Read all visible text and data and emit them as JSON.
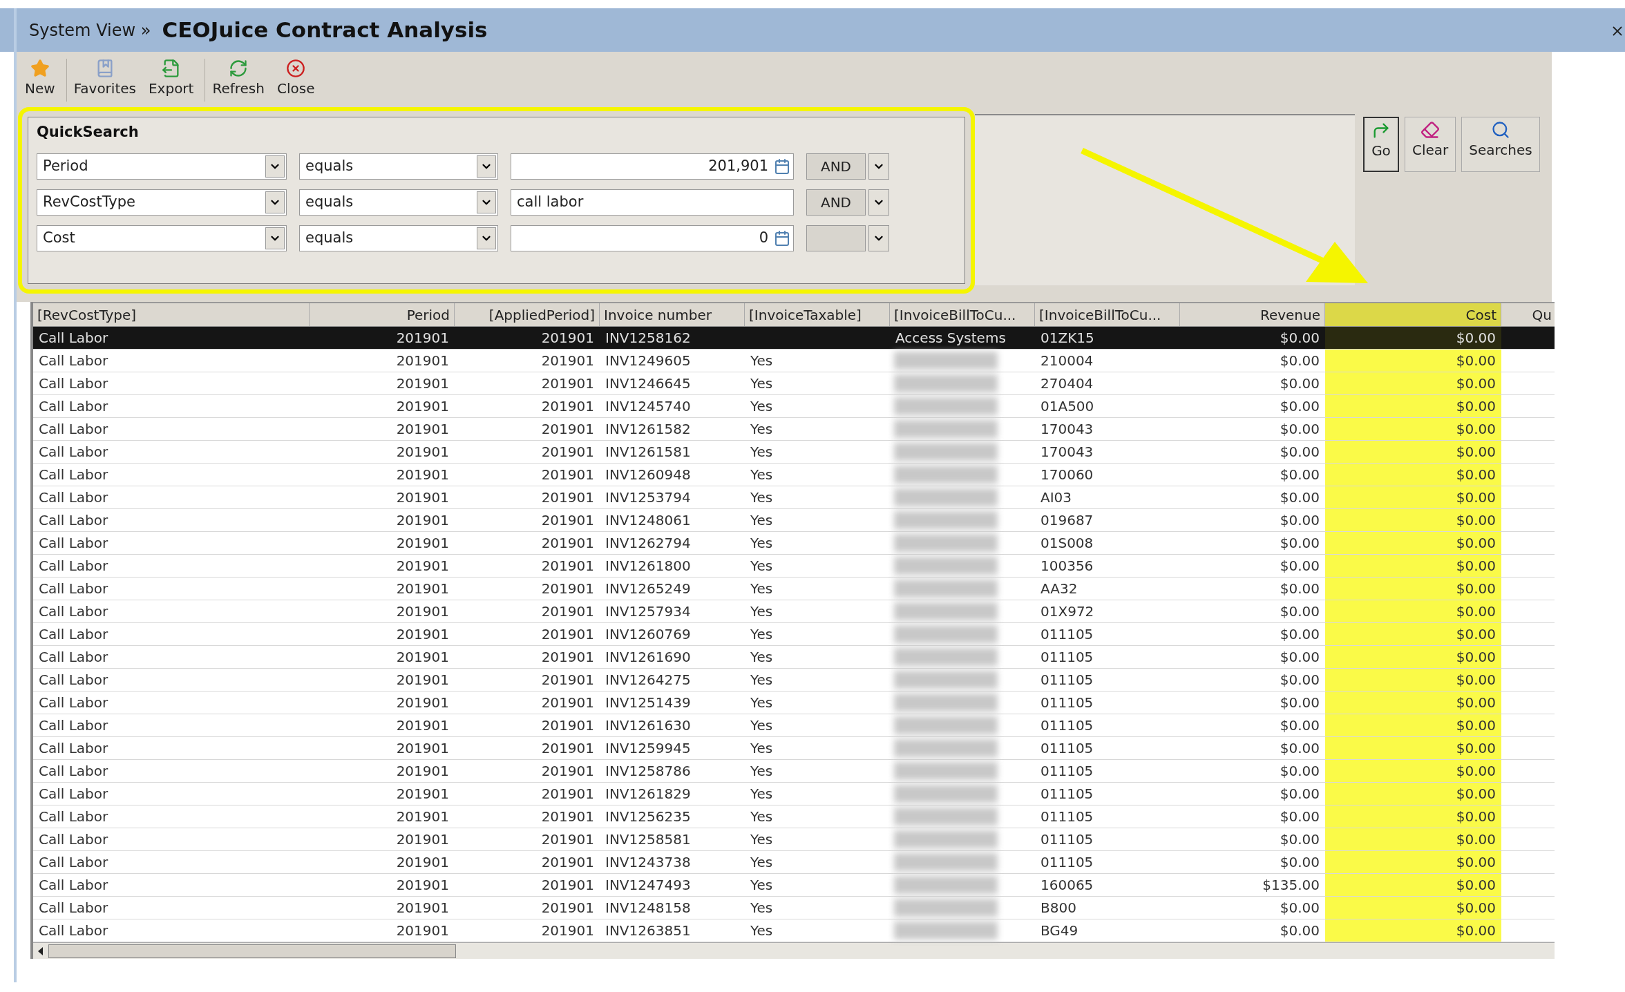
{
  "window": {
    "breadcrumb": "System View »",
    "title": "CEOJuice Contract Analysis"
  },
  "toolbar": [
    {
      "label": "New",
      "kind": "new"
    },
    {
      "label": "Favorites",
      "kind": "favorites"
    },
    {
      "label": "Export",
      "kind": "export"
    },
    {
      "label": "Refresh",
      "kind": "refresh"
    },
    {
      "label": "Close",
      "kind": "close"
    }
  ],
  "quicksearch": {
    "title": "QuickSearch",
    "highlighted": true,
    "rows": [
      {
        "field": "Period",
        "operator": "equals",
        "value": "201,901",
        "kind": "number",
        "join": "AND"
      },
      {
        "field": "RevCostType",
        "operator": "equals",
        "value": "call labor",
        "kind": "text",
        "join": "AND"
      },
      {
        "field": "Cost",
        "operator": "equals",
        "value": "0",
        "kind": "number"
      }
    ]
  },
  "search_buttons": [
    {
      "label": "Go",
      "kind": "go"
    },
    {
      "label": "Clear",
      "kind": "clear"
    },
    {
      "label": "Searches",
      "kind": "searches"
    }
  ],
  "annotation_arrow": true,
  "table": {
    "columns": [
      {
        "label": "[RevCostType]",
        "highlighted": false
      },
      {
        "label": "Period",
        "highlighted": false
      },
      {
        "label": "[AppliedPeriod]",
        "highlighted": false
      },
      {
        "label": "Invoice number",
        "highlighted": false
      },
      {
        "label": "[InvoiceTaxable]",
        "highlighted": false
      },
      {
        "label": "[InvoiceBillToCu...",
        "highlighted": false
      },
      {
        "label": "[InvoiceBillToCu...",
        "highlighted": false
      },
      {
        "label": "Revenue",
        "highlighted": false
      },
      {
        "label": "Cost",
        "highlighted": true
      },
      {
        "label": "Qu",
        "highlighted": false
      }
    ],
    "rows": [
      {
        "cells": [
          "Call Labor",
          "201901",
          "201901",
          "INV1258162",
          "",
          "Access Systems",
          "01ZK15",
          "$0.00",
          "$0.00"
        ],
        "selected": true
      },
      {
        "cells": [
          "Call Labor",
          "201901",
          "201901",
          "INV1249605",
          "Yes",
          "",
          "210004",
          "$0.00",
          "$0.00"
        ],
        "selected": false
      },
      {
        "cells": [
          "Call Labor",
          "201901",
          "201901",
          "INV1246645",
          "Yes",
          "",
          "270404",
          "$0.00",
          "$0.00"
        ],
        "selected": false
      },
      {
        "cells": [
          "Call Labor",
          "201901",
          "201901",
          "INV1245740",
          "Yes",
          "",
          "01A500",
          "$0.00",
          "$0.00"
        ],
        "selected": false
      },
      {
        "cells": [
          "Call Labor",
          "201901",
          "201901",
          "INV1261582",
          "Yes",
          "",
          "170043",
          "$0.00",
          "$0.00"
        ],
        "selected": false
      },
      {
        "cells": [
          "Call Labor",
          "201901",
          "201901",
          "INV1261581",
          "Yes",
          "",
          "170043",
          "$0.00",
          "$0.00"
        ],
        "selected": false
      },
      {
        "cells": [
          "Call Labor",
          "201901",
          "201901",
          "INV1260948",
          "Yes",
          "",
          "170060",
          "$0.00",
          "$0.00"
        ],
        "selected": false
      },
      {
        "cells": [
          "Call Labor",
          "201901",
          "201901",
          "INV1253794",
          "Yes",
          "",
          "AI03",
          "$0.00",
          "$0.00"
        ],
        "selected": false
      },
      {
        "cells": [
          "Call Labor",
          "201901",
          "201901",
          "INV1248061",
          "Yes",
          "",
          "019687",
          "$0.00",
          "$0.00"
        ],
        "selected": false
      },
      {
        "cells": [
          "Call Labor",
          "201901",
          "201901",
          "INV1262794",
          "Yes",
          "",
          "01S008",
          "$0.00",
          "$0.00"
        ],
        "selected": false
      },
      {
        "cells": [
          "Call Labor",
          "201901",
          "201901",
          "INV1261800",
          "Yes",
          "",
          "100356",
          "$0.00",
          "$0.00"
        ],
        "selected": false
      },
      {
        "cells": [
          "Call Labor",
          "201901",
          "201901",
          "INV1265249",
          "Yes",
          "",
          "AA32",
          "$0.00",
          "$0.00"
        ],
        "selected": false
      },
      {
        "cells": [
          "Call Labor",
          "201901",
          "201901",
          "INV1257934",
          "Yes",
          "",
          "01X972",
          "$0.00",
          "$0.00"
        ],
        "selected": false
      },
      {
        "cells": [
          "Call Labor",
          "201901",
          "201901",
          "INV1260769",
          "Yes",
          "",
          "011105",
          "$0.00",
          "$0.00"
        ],
        "selected": false
      },
      {
        "cells": [
          "Call Labor",
          "201901",
          "201901",
          "INV1261690",
          "Yes",
          "",
          "011105",
          "$0.00",
          "$0.00"
        ],
        "selected": false
      },
      {
        "cells": [
          "Call Labor",
          "201901",
          "201901",
          "INV1264275",
          "Yes",
          "",
          "011105",
          "$0.00",
          "$0.00"
        ],
        "selected": false
      },
      {
        "cells": [
          "Call Labor",
          "201901",
          "201901",
          "INV1251439",
          "Yes",
          "",
          "011105",
          "$0.00",
          "$0.00"
        ],
        "selected": false
      },
      {
        "cells": [
          "Call Labor",
          "201901",
          "201901",
          "INV1261630",
          "Yes",
          "",
          "011105",
          "$0.00",
          "$0.00"
        ],
        "selected": false
      },
      {
        "cells": [
          "Call Labor",
          "201901",
          "201901",
          "INV1259945",
          "Yes",
          "",
          "011105",
          "$0.00",
          "$0.00"
        ],
        "selected": false
      },
      {
        "cells": [
          "Call Labor",
          "201901",
          "201901",
          "INV1258786",
          "Yes",
          "",
          "011105",
          "$0.00",
          "$0.00"
        ],
        "selected": false
      },
      {
        "cells": [
          "Call Labor",
          "201901",
          "201901",
          "INV1261829",
          "Yes",
          "",
          "011105",
          "$0.00",
          "$0.00"
        ],
        "selected": false
      },
      {
        "cells": [
          "Call Labor",
          "201901",
          "201901",
          "INV1256235",
          "Yes",
          "",
          "011105",
          "$0.00",
          "$0.00"
        ],
        "selected": false
      },
      {
        "cells": [
          "Call Labor",
          "201901",
          "201901",
          "INV1258581",
          "Yes",
          "",
          "011105",
          "$0.00",
          "$0.00"
        ],
        "selected": false
      },
      {
        "cells": [
          "Call Labor",
          "201901",
          "201901",
          "INV1243738",
          "Yes",
          "",
          "011105",
          "$0.00",
          "$0.00"
        ],
        "selected": false
      },
      {
        "cells": [
          "Call Labor",
          "201901",
          "201901",
          "INV1247493",
          "Yes",
          "",
          "160065",
          "$135.00",
          "$0.00"
        ],
        "selected": false
      },
      {
        "cells": [
          "Call Labor",
          "201901",
          "201901",
          "INV1248158",
          "Yes",
          "",
          "B800",
          "$0.00",
          "$0.00"
        ],
        "selected": false
      },
      {
        "cells": [
          "Call Labor",
          "201901",
          "201901",
          "INV1263851",
          "Yes",
          "",
          "BG49",
          "$0.00",
          "$0.00"
        ],
        "selected": false
      }
    ]
  }
}
